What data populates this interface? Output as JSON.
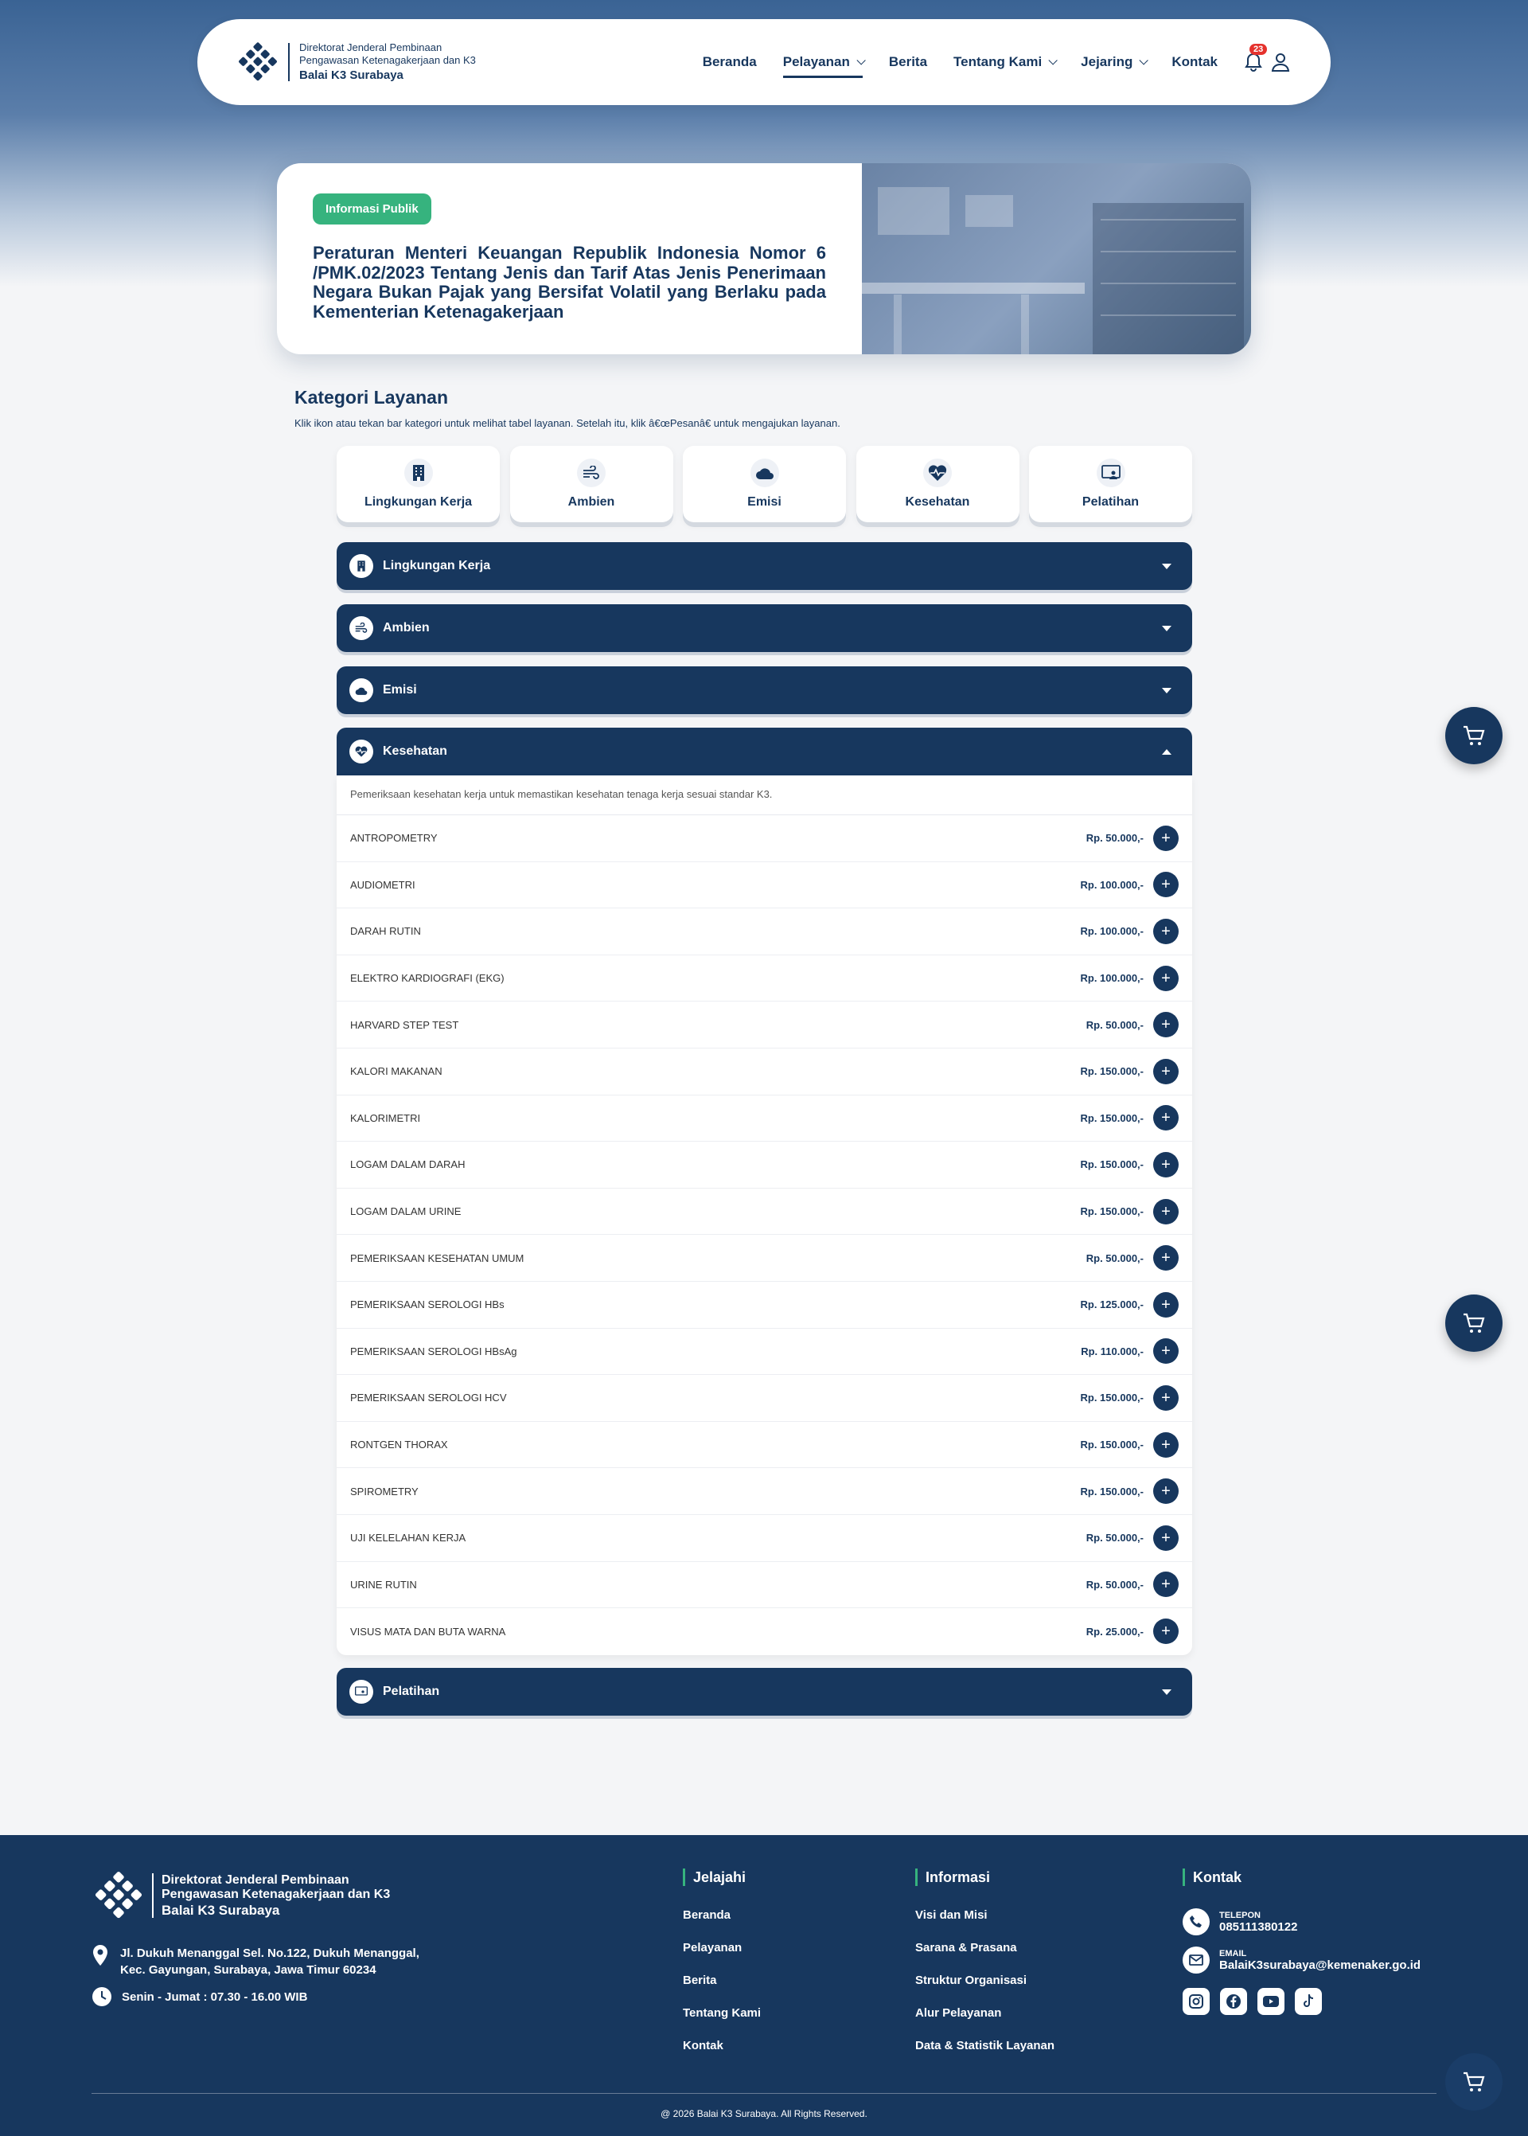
{
  "nav": {
    "brand_line1": "Direktorat Jenderal Pembinaan",
    "brand_line2": "Pengawasan Ketenagakerjaan dan K3",
    "brand_line3": "Balai K3 Surabaya",
    "items": [
      {
        "label": "Beranda"
      },
      {
        "label": "Pelayanan"
      },
      {
        "label": "Berita"
      },
      {
        "label": "Tentang Kami"
      },
      {
        "label": "Jejaring"
      },
      {
        "label": "Kontak"
      }
    ],
    "notif_count": "23"
  },
  "hero": {
    "badge": "Informasi Publik",
    "title": "Peraturan Menteri Keuangan Republik Indonesia Nomor 6 /PMK.02/2023 Tentang Jenis dan Tarif Atas Jenis Penerimaan Negara Bukan Pajak yang Bersifat Volatil yang Berlaku pada Kementerian Ketenagakerjaan"
  },
  "kategori": {
    "title": "Kategori Layanan",
    "subtitle": "Klik ikon atau tekan bar kategori untuk melihat tabel layanan. Setelah itu, klik â€œPesanâ€ untuk mengajukan layanan.",
    "cards": [
      {
        "label": "Lingkungan Kerja",
        "icon": "building-icon"
      },
      {
        "label": "Ambien",
        "icon": "wind-icon"
      },
      {
        "label": "Emisi",
        "icon": "cloud-icon"
      },
      {
        "label": "Kesehatan",
        "icon": "heartbeat-icon"
      },
      {
        "label": "Pelatihan",
        "icon": "training-icon"
      }
    ]
  },
  "accordions": [
    {
      "title": "Lingkungan Kerja"
    },
    {
      "title": "Ambien"
    },
    {
      "title": "Emisi"
    },
    {
      "title": "Kesehatan"
    },
    {
      "title": "Pelatihan"
    }
  ],
  "kesehatan": {
    "description": "Pemeriksaan kesehatan kerja untuk memastikan kesehatan tenaga kerja sesuai standar K3.",
    "services": [
      {
        "name": "ANTROPOMETRY",
        "price": "Rp. 50.000,-"
      },
      {
        "name": "AUDIOMETRI",
        "price": "Rp. 100.000,-"
      },
      {
        "name": "DARAH RUTIN",
        "price": "Rp. 100.000,-"
      },
      {
        "name": "ELEKTRO KARDIOGRAFI (EKG)",
        "price": "Rp. 100.000,-"
      },
      {
        "name": "HARVARD STEP TEST",
        "price": "Rp. 50.000,-"
      },
      {
        "name": "KALORI MAKANAN",
        "price": "Rp. 150.000,-"
      },
      {
        "name": "KALORIMETRI",
        "price": "Rp. 150.000,-"
      },
      {
        "name": "LOGAM DALAM DARAH",
        "price": "Rp. 150.000,-"
      },
      {
        "name": "LOGAM DALAM URINE",
        "price": "Rp. 150.000,-"
      },
      {
        "name": "PEMERIKSAAN KESEHATAN UMUM",
        "price": "Rp. 50.000,-"
      },
      {
        "name": "PEMERIKSAAN SEROLOGI HBs",
        "price": "Rp. 125.000,-"
      },
      {
        "name": "PEMERIKSAAN SEROLOGI HBsAg",
        "price": "Rp. 110.000,-"
      },
      {
        "name": "PEMERIKSAAN SEROLOGI HCV",
        "price": "Rp. 150.000,-"
      },
      {
        "name": "RONTGEN THORAX",
        "price": "Rp. 150.000,-"
      },
      {
        "name": "SPIROMETRY",
        "price": "Rp. 150.000,-"
      },
      {
        "name": "UJI KELELAHAN KERJA",
        "price": "Rp. 50.000,-"
      },
      {
        "name": "URINE RUTIN",
        "price": "Rp. 50.000,-"
      },
      {
        "name": "VISUS MATA DAN BUTA WARNA",
        "price": "Rp. 25.000,-"
      }
    ],
    "add_symbol": "+"
  },
  "footer": {
    "brand_line1": "Direktorat Jenderal Pembinaan",
    "brand_line2": "Pengawasan Ketenagakerjaan dan K3",
    "brand_line3": "Balai K3 Surabaya",
    "address_line1": "Jl. Dukuh Menanggal Sel. No.122, Dukuh Menanggal,",
    "address_line2": "Kec. Gayungan, Surabaya, Jawa Timur 60234",
    "hours": "Senin - Jumat : 07.30 - 16.00 WIB",
    "jelajahi": {
      "title": "Jelajahi",
      "links": [
        "Beranda",
        "Pelayanan",
        "Berita",
        "Tentang Kami",
        "Kontak"
      ]
    },
    "informasi": {
      "title": "Informasi",
      "links": [
        "Visi dan Misi",
        "Sarana & Prasana",
        "Struktur Organisasi",
        "Alur Pelayanan",
        "Data & Statistik Layanan"
      ]
    },
    "kontak": {
      "title": "Kontak",
      "phone_label": "TELEPON",
      "phone": "085111380122",
      "email_label": "EMAIL",
      "email": "BalaiK3surabaya@kemenaker.go.id"
    },
    "copyright": "@ 2026 Balai K3 Surabaya. All Rights Reserved."
  },
  "colors": {
    "primary": "#17375e",
    "accent_green": "#36b37e",
    "badge_red": "#e5322d"
  }
}
